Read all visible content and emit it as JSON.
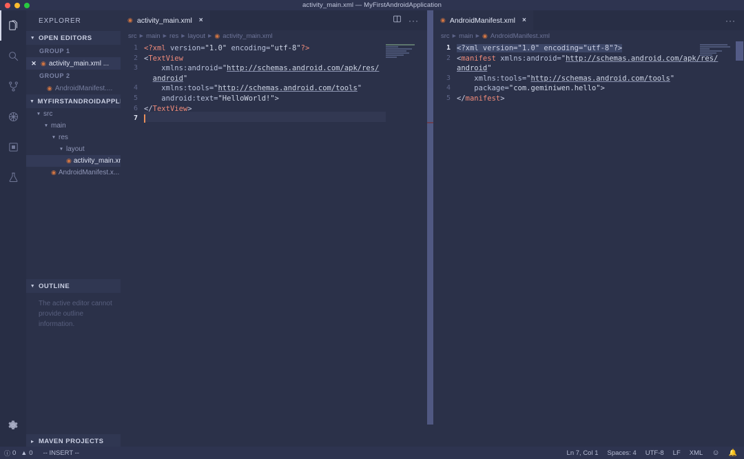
{
  "window": {
    "title": "activity_main.xml — MyFirstAndroidApplication",
    "traffic_lights": [
      "close",
      "minimize",
      "maximize"
    ]
  },
  "activity_bar": {
    "items": [
      {
        "name": "explorer-icon",
        "label": "Explorer",
        "active": true
      },
      {
        "name": "search-icon",
        "label": "Search",
        "active": false
      },
      {
        "name": "source-control-icon",
        "label": "Source Control",
        "active": false
      },
      {
        "name": "debug-icon",
        "label": "Run and Debug",
        "active": false
      },
      {
        "name": "extensions-icon",
        "label": "Extensions",
        "active": false
      },
      {
        "name": "testing-flask-icon",
        "label": "Testing",
        "active": false
      }
    ],
    "settings": {
      "name": "gear-icon",
      "label": "Manage"
    }
  },
  "sidebar": {
    "title": "EXPLORER",
    "open_editors": {
      "header": "OPEN EDITORS",
      "expanded": true,
      "groups": [
        {
          "label": "GROUP 1",
          "items": [
            {
              "name": "activity_main.xml ...",
              "selected": true,
              "dirty": false,
              "icon": "xml-file-icon"
            }
          ]
        },
        {
          "label": "GROUP 2",
          "items": [
            {
              "name": "AndroidManifest....",
              "selected": false,
              "dirty": false,
              "icon": "xml-file-icon"
            }
          ]
        }
      ]
    },
    "project": {
      "header": "MYFIRSTANDROIDAPPLI...",
      "expanded": true,
      "tree": [
        {
          "label": "src",
          "depth": 1,
          "type": "folder",
          "expanded": true,
          "selected": false
        },
        {
          "label": "main",
          "depth": 2,
          "type": "folder",
          "expanded": true,
          "selected": false
        },
        {
          "label": "res",
          "depth": 3,
          "type": "folder",
          "expanded": true,
          "selected": false
        },
        {
          "label": "layout",
          "depth": 4,
          "type": "folder",
          "expanded": true,
          "selected": false
        },
        {
          "label": "activity_main.xml",
          "depth": 5,
          "type": "file",
          "icon": "xml-file-icon",
          "selected": true
        },
        {
          "label": "AndroidManifest.x...",
          "depth": 4,
          "type": "file",
          "icon": "xml-file-icon",
          "selected": false
        }
      ]
    },
    "outline": {
      "header": "OUTLINE",
      "expanded": true,
      "message": "The active editor cannot provide outline information."
    },
    "maven": {
      "header": "MAVEN PROJECTS",
      "expanded": false
    }
  },
  "editor_left": {
    "tab": {
      "label": "activity_main.xml",
      "icon": "xml-file-icon",
      "active": true,
      "close": "×"
    },
    "actions": {
      "split_editor": "split-editor-icon",
      "more": "···"
    },
    "breadcrumbs": [
      "src",
      "main",
      "res",
      "layout",
      "activity_main.xml"
    ],
    "cursor_line": 7,
    "lines": [
      {
        "num": 1,
        "tokens": [
          {
            "t": "pi",
            "v": "<?xml "
          },
          {
            "t": "attr",
            "v": "version="
          },
          {
            "t": "str",
            "v": "\"1.0\""
          },
          {
            "t": "plain",
            "v": " "
          },
          {
            "t": "attr",
            "v": "encoding="
          },
          {
            "t": "str",
            "v": "\"utf-8\""
          },
          {
            "t": "pi",
            "v": "?>"
          }
        ],
        "indent": 0
      },
      {
        "num": 2,
        "tokens": [
          {
            "t": "punct",
            "v": "<"
          },
          {
            "t": "tag",
            "v": "TextView"
          }
        ],
        "indent": 0
      },
      {
        "num": 3,
        "tokens": [
          {
            "t": "attr",
            "v": "xmlns:android="
          },
          {
            "t": "punct",
            "v": "\""
          },
          {
            "t": "url",
            "v": "http://schemas.android.com/apk/res/"
          }
        ],
        "indent": 4
      },
      {
        "num": null,
        "tokens": [
          {
            "t": "url",
            "v": "android"
          },
          {
            "t": "punct",
            "v": "\""
          }
        ],
        "indent": 2
      },
      {
        "num": 4,
        "tokens": [
          {
            "t": "attr",
            "v": "xmlns:tools="
          },
          {
            "t": "punct",
            "v": "\""
          },
          {
            "t": "url",
            "v": "http://schemas.android.com/tools"
          },
          {
            "t": "punct",
            "v": "\""
          }
        ],
        "indent": 4
      },
      {
        "num": 5,
        "tokens": [
          {
            "t": "attr",
            "v": "android:text="
          },
          {
            "t": "str",
            "v": "\"HelloWorld!\""
          },
          {
            "t": "punct",
            "v": ">"
          }
        ],
        "indent": 4
      },
      {
        "num": 6,
        "tokens": [
          {
            "t": "punct",
            "v": "</"
          },
          {
            "t": "tag",
            "v": "TextView"
          },
          {
            "t": "punct",
            "v": ">"
          }
        ],
        "indent": 0
      },
      {
        "num": 7,
        "tokens": [],
        "indent": 0,
        "caret": true
      }
    ]
  },
  "editor_right": {
    "tab": {
      "label": "AndroidManifest.xml",
      "icon": "xml-file-icon",
      "active": true,
      "close": "×"
    },
    "actions": {
      "more": "···"
    },
    "breadcrumbs": [
      "src",
      "main",
      "AndroidManifest.xml"
    ],
    "cursor_line": 1,
    "lines": [
      {
        "num": 1,
        "tokens": [
          {
            "t": "sel",
            "v": "<?xml version=\"1.0\" encoding=\"utf-8\"?>"
          }
        ],
        "indent": 0,
        "selected": true
      },
      {
        "num": 2,
        "tokens": [
          {
            "t": "punct",
            "v": "<"
          },
          {
            "t": "tag",
            "v": "manifest"
          },
          {
            "t": "plain",
            "v": " "
          },
          {
            "t": "attr",
            "v": "xmlns:android="
          },
          {
            "t": "punct",
            "v": "\""
          },
          {
            "t": "url",
            "v": "http://schemas.android.com/apk/res/"
          }
        ],
        "indent": 0
      },
      {
        "num": null,
        "tokens": [
          {
            "t": "url",
            "v": "android"
          },
          {
            "t": "punct",
            "v": "\""
          }
        ],
        "indent": 0
      },
      {
        "num": 3,
        "tokens": [
          {
            "t": "attr",
            "v": "xmlns:tools="
          },
          {
            "t": "punct",
            "v": "\""
          },
          {
            "t": "url",
            "v": "http://schemas.android.com/tools"
          },
          {
            "t": "punct",
            "v": "\""
          }
        ],
        "indent": 4
      },
      {
        "num": 4,
        "tokens": [
          {
            "t": "attr",
            "v": "package="
          },
          {
            "t": "str",
            "v": "\"com.geminiwen.hello\""
          },
          {
            "t": "punct",
            "v": ">"
          }
        ],
        "indent": 4
      },
      {
        "num": 5,
        "tokens": [
          {
            "t": "punct",
            "v": "</"
          },
          {
            "t": "tag",
            "v": "manifest"
          },
          {
            "t": "punct",
            "v": ">"
          }
        ],
        "indent": 0
      }
    ]
  },
  "status_bar": {
    "left": [
      {
        "name": "error-count",
        "icon": "error-circle-icon",
        "value": "0"
      },
      {
        "name": "warning-count",
        "icon": "warning-triangle-icon",
        "value": "0"
      },
      {
        "name": "vim-mode",
        "value": "-- INSERT --"
      }
    ],
    "right": [
      {
        "name": "cursor-position",
        "value": "Ln 7, Col 1"
      },
      {
        "name": "indentation",
        "value": "Spaces: 4"
      },
      {
        "name": "encoding",
        "value": "UTF-8"
      },
      {
        "name": "eol",
        "value": "LF"
      },
      {
        "name": "language-mode",
        "value": "XML"
      },
      {
        "name": "feedback-smiley-icon",
        "value": "☺"
      },
      {
        "name": "notifications-bell-icon",
        "value": "🔔"
      }
    ]
  },
  "colors": {
    "background": "#2b3149",
    "chrome": "#282e45",
    "titlebar": "#2e3450",
    "accent_orange": "#cf7442",
    "tag_red": "#f08b7a",
    "text": "#c9cee2",
    "muted": "#7c84a6",
    "selection": "#3d4767"
  }
}
